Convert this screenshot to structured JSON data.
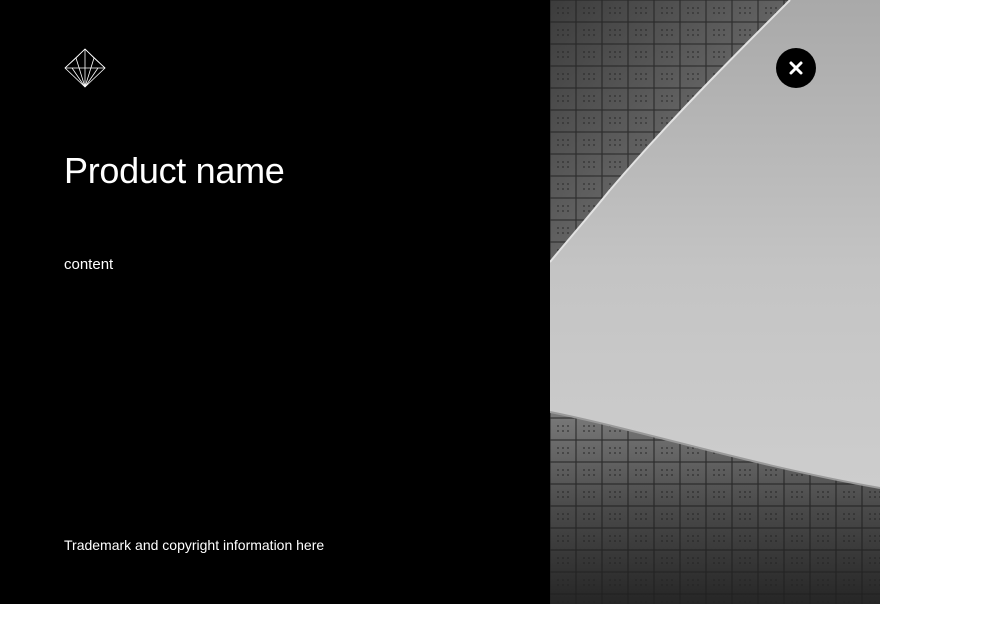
{
  "dialog": {
    "logo_icon": "diamond-crystal-logo-icon",
    "title": "Product name",
    "content": "content",
    "legal": "Trademark and copyright information here",
    "close_icon": "close-icon",
    "background_image": "curved-building-facade-photo",
    "colors": {
      "left_panel": "#000000",
      "text": "#ffffff",
      "close_button": "#000000",
      "page_background": "#ffffff"
    }
  }
}
